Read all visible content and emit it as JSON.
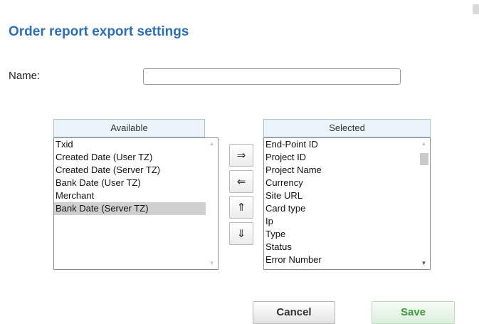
{
  "page": {
    "title": "Order report export settings"
  },
  "form": {
    "name_label": "Name:",
    "name_value": "",
    "name_placeholder": ""
  },
  "available": {
    "header": "Available",
    "items": [
      "Txid",
      "Created Date (User TZ)",
      "Created Date (Server TZ)",
      "Bank Date (User TZ)",
      "Merchant",
      "Bank Date (Server TZ)"
    ],
    "selected_item": "Bank Date (Server TZ)"
  },
  "selected": {
    "header": "Selected",
    "items": [
      "End-Point ID",
      "Project ID",
      "Project Name",
      "Currency",
      "Site URL",
      "Card type",
      "Ip",
      "Type",
      "Status",
      "Error Number"
    ]
  },
  "transfer_buttons": {
    "add": "⇒",
    "remove": "⇐",
    "move_up": "⇑",
    "move_down": "⇓"
  },
  "actions": {
    "cancel_label": "Cancel",
    "save_label": "Save"
  },
  "icons": {
    "scroll_up": "scroll-up-arrow-icon",
    "scroll_down": "scroll-down-arrow-icon"
  },
  "colors": {
    "title": "#2e6fb3",
    "list_header_bg": "#eaf4f9",
    "selection_bg": "#cfcfcf",
    "save_text": "#3d9a3d"
  }
}
